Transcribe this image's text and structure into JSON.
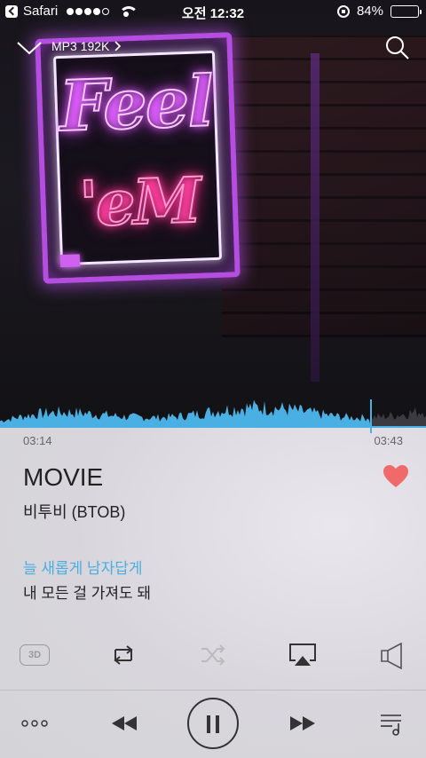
{
  "status_bar": {
    "back_app": "Safari",
    "signal_bars_filled": 4,
    "signal_bars_total": 5,
    "time": "오전 12:32",
    "battery_percent": "84%",
    "battery_level": 0.84
  },
  "header": {
    "quality_label": "MP3 192K"
  },
  "player": {
    "current_time": "03:14",
    "total_time": "03:43",
    "progress": 0.87,
    "song_title": "MOVIE",
    "artist": "비투비 (BTOB)",
    "liked": true
  },
  "lyrics": {
    "current": "늘 새롭게 남자답게",
    "next": "내 모든 걸 가져도 돼"
  },
  "controls": {
    "three_d_label": "3D"
  },
  "colors": {
    "accent": "#4aaee0",
    "heart": "#f06a6a",
    "wave": "#4ab0e4"
  },
  "icons": {
    "collapse": "chevron-down-icon",
    "search": "search-icon",
    "heart": "heart-icon",
    "repeat": "repeat-icon",
    "shuffle": "shuffle-icon",
    "airplay": "airplay-icon",
    "speaker": "speaker-icon",
    "more": "more-icon",
    "rewind": "rewind-icon",
    "pause": "pause-icon",
    "forward": "fast-forward-icon",
    "playlist": "playlist-icon"
  }
}
